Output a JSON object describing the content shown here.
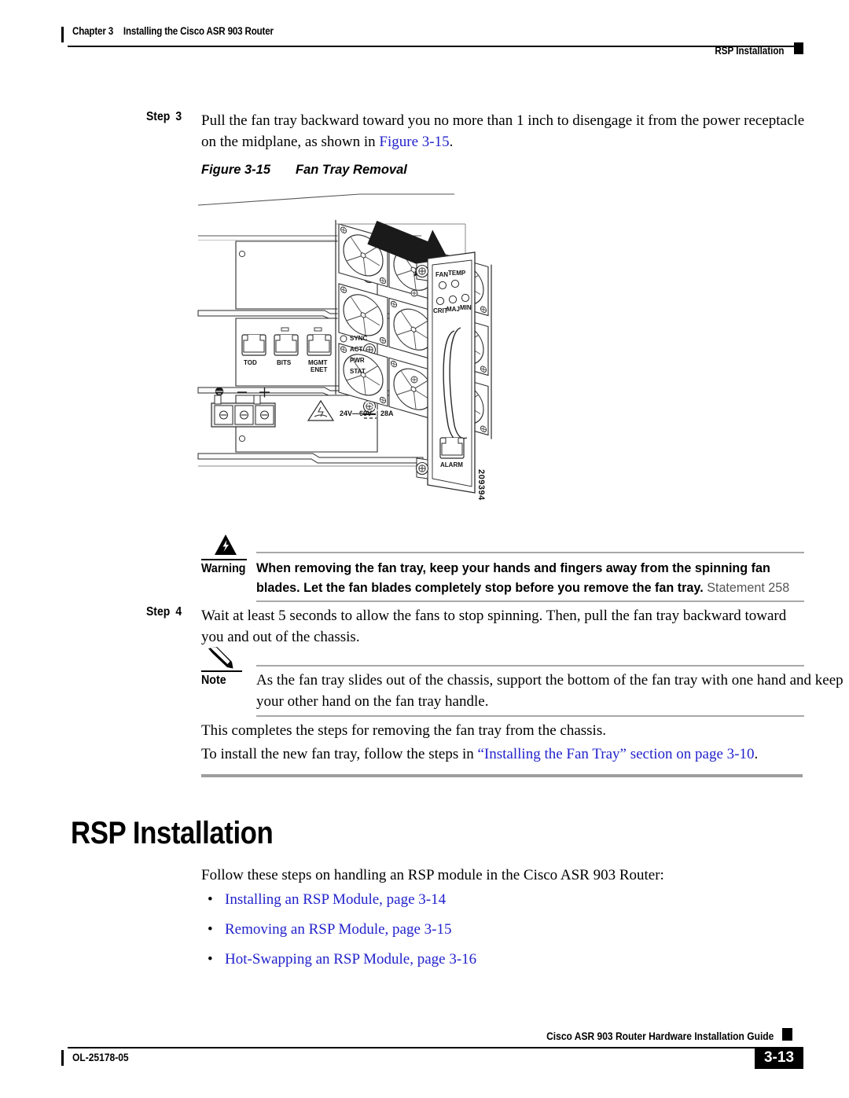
{
  "header": {
    "chapter_number": "Chapter 3",
    "chapter_title": "Installing the Cisco ASR 903 Router",
    "running_head": "RSP Installation"
  },
  "step3": {
    "label_word": "Step",
    "label_number": "3",
    "text_before_link": "Pull the fan tray backward toward you no more than 1 inch to disengage it from the power receptacle on the midplane, as shown in ",
    "link": "Figure 3-15",
    "text_after_link": "."
  },
  "figure": {
    "number": "Figure 3-15",
    "title": "Fan Tray Removal",
    "art_id": "209394",
    "chassis_ports": [
      {
        "label": "TOD"
      },
      {
        "label": "BITS"
      },
      {
        "label_line1": "MGMT",
        "label_line2": "ENET"
      }
    ],
    "chassis_leds": [
      "SYNC",
      "ACT",
      "PWR",
      "STAT"
    ],
    "power_terminal": {
      "symbols": [
        "ground",
        "minus",
        "plus"
      ],
      "rating": "24V—60V",
      "dc_symbol": "===",
      "current": "28A"
    },
    "fan_tray_panel": {
      "top_leds": [
        "FAN",
        "TEMP"
      ],
      "alarm_leds": [
        "CRIT",
        "MAJ",
        "MIN"
      ],
      "alarm_port_label": "ALARM"
    }
  },
  "warning": {
    "word": "Warning",
    "icon": "warning-lightning-triangle-icon",
    "text": "When removing the fan tray, keep your hands and fingers away from the spinning fan blades. Let the fan blades completely stop before you remove the fan tray.",
    "statement": "Statement 258"
  },
  "step4": {
    "label_word": "Step",
    "label_number": "4",
    "text": "Wait at least 5 seconds to allow the fans to stop spinning. Then, pull the fan tray backward toward you and out of the chassis."
  },
  "note": {
    "word": "Note",
    "icon": "pencil-icon",
    "text": "As the fan tray slides out of the chassis, support the bottom of the fan tray with one hand and keep your other hand on the fan tray handle."
  },
  "closing": {
    "paragraph1": "This completes the steps for removing the fan tray from the chassis.",
    "paragraph2_before": "To install the new fan tray, follow the steps in ",
    "paragraph2_link": "“Installing the Fan Tray” section on page 3-10",
    "paragraph2_after": "."
  },
  "section": {
    "heading": "RSP Installation",
    "intro": "Follow these steps on handling an RSP module in the Cisco ASR 903 Router:",
    "bullets": [
      {
        "bullet": "•",
        "label": "Installing an RSP Module, page 3-14"
      },
      {
        "bullet": "•",
        "label": "Removing an RSP Module, page 3-15"
      },
      {
        "bullet": "•",
        "label": "Hot-Swapping an RSP Module, page 3-16"
      }
    ]
  },
  "footer": {
    "guide_title": "Cisco ASR 903 Router Hardware Installation Guide",
    "doc_number": "OL-25178-05",
    "page_number": "3-13"
  },
  "colors": {
    "link": "#2222cc",
    "rule_gray": "#a8a8a8",
    "section_rule": "#9d9d9d",
    "text": "#000000"
  }
}
